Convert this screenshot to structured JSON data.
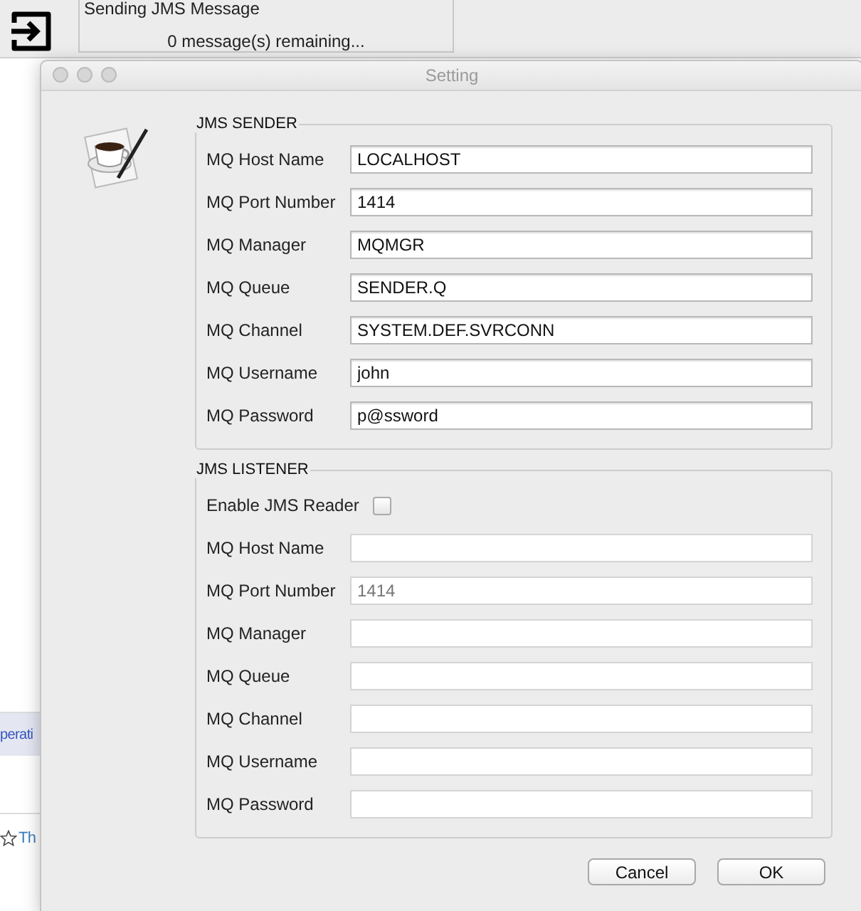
{
  "background_window": {
    "progress_group": {
      "title": "Sending JMS Message",
      "status": "0 message(s) remaining..."
    },
    "list_items": [
      {
        "text": "perati",
        "selected": true
      },
      {
        "text": "Th",
        "selected": false
      }
    ]
  },
  "dialog": {
    "title": "Setting",
    "sender": {
      "title": "JMS SENDER",
      "fields": [
        {
          "label": "MQ Host Name",
          "value": "LOCALHOST",
          "disabled": false
        },
        {
          "label": "MQ Port Number",
          "value": "1414",
          "disabled": false
        },
        {
          "label": "MQ Manager",
          "value": "MQMGR",
          "disabled": false
        },
        {
          "label": "MQ Queue",
          "value": "SENDER.Q",
          "disabled": false
        },
        {
          "label": "MQ Channel",
          "value": "SYSTEM.DEF.SVRCONN",
          "disabled": false
        },
        {
          "label": "MQ Username",
          "value": "john",
          "disabled": false
        },
        {
          "label": "MQ Password",
          "value": "p@ssword",
          "disabled": false
        }
      ]
    },
    "listener": {
      "title": "JMS LISTENER",
      "enable": {
        "label": "Enable JMS Reader",
        "checked": false
      },
      "fields": [
        {
          "label": "MQ Host Name",
          "disabled": true
        },
        {
          "label": "MQ Port Number",
          "placeholder": "1414",
          "disabled": true
        },
        {
          "label": "MQ Manager",
          "disabled": true
        },
        {
          "label": "MQ Queue",
          "disabled": true
        },
        {
          "label": "MQ Channel",
          "disabled": true
        },
        {
          "label": "MQ Username",
          "disabled": true
        },
        {
          "label": "MQ Password",
          "disabled": true
        }
      ]
    },
    "buttons": [
      "Cancel",
      "OK"
    ]
  }
}
